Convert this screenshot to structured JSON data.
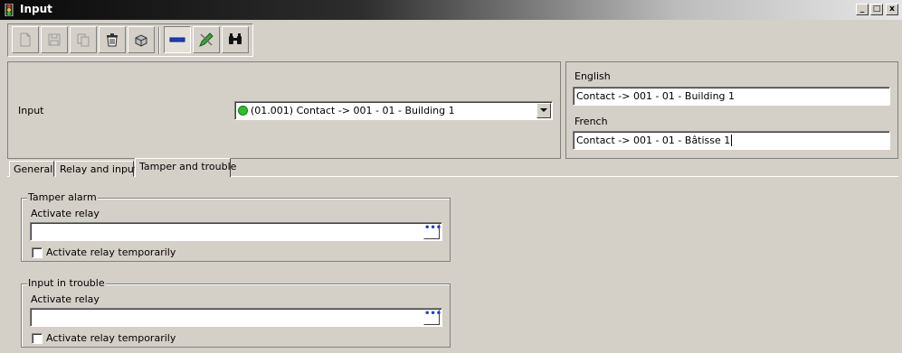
{
  "window": {
    "title": "Input",
    "controls": {
      "minimize": "_",
      "restore": "□",
      "close": "x"
    }
  },
  "toolbar": {
    "buttons": [
      {
        "icon": "new-document-icon",
        "enabled": false,
        "pressed": false
      },
      {
        "icon": "save-icon",
        "enabled": false,
        "pressed": false
      },
      {
        "icon": "copy-icon",
        "enabled": false,
        "pressed": false
      },
      {
        "icon": "delete-icon",
        "enabled": true,
        "pressed": false
      },
      {
        "icon": "print-icon",
        "enabled": true,
        "pressed": false
      },
      {
        "icon": "minus-icon",
        "enabled": true,
        "pressed": true
      },
      {
        "icon": "pencil-icon",
        "enabled": true,
        "pressed": false
      },
      {
        "icon": "binoculars-icon",
        "enabled": true,
        "pressed": false
      }
    ]
  },
  "header": {
    "input_label": "Input",
    "input_select_value": "(01.001) Contact -> 001 - 01 - Building 1",
    "status_color": "#2fbf2f",
    "languages": [
      {
        "label": "English",
        "value": "Contact -> 001 - 01 - Building 1"
      },
      {
        "label": "French",
        "value": "Contact -> 001 - 01 - Bâtisse 1"
      }
    ]
  },
  "tabs": [
    {
      "label": "General",
      "active": false
    },
    {
      "label": "Relay and input",
      "active": false
    },
    {
      "label": "Tamper and trouble",
      "active": true
    }
  ],
  "groups": [
    {
      "title": "Tamper alarm",
      "field_label": "Activate relay",
      "field_value": "",
      "browse_label": "•••",
      "checkbox_label": "Activate relay temporarily",
      "checked": false
    },
    {
      "title": "Input in trouble",
      "field_label": "Activate relay",
      "field_value": "",
      "browse_label": "•••",
      "checkbox_label": "Activate relay temporarily",
      "checked": false
    }
  ],
  "colors": {
    "titlebar_dark": "#0a0a0a",
    "face": "#d4d0c8",
    "accent_blue": "#1f3fbf"
  }
}
